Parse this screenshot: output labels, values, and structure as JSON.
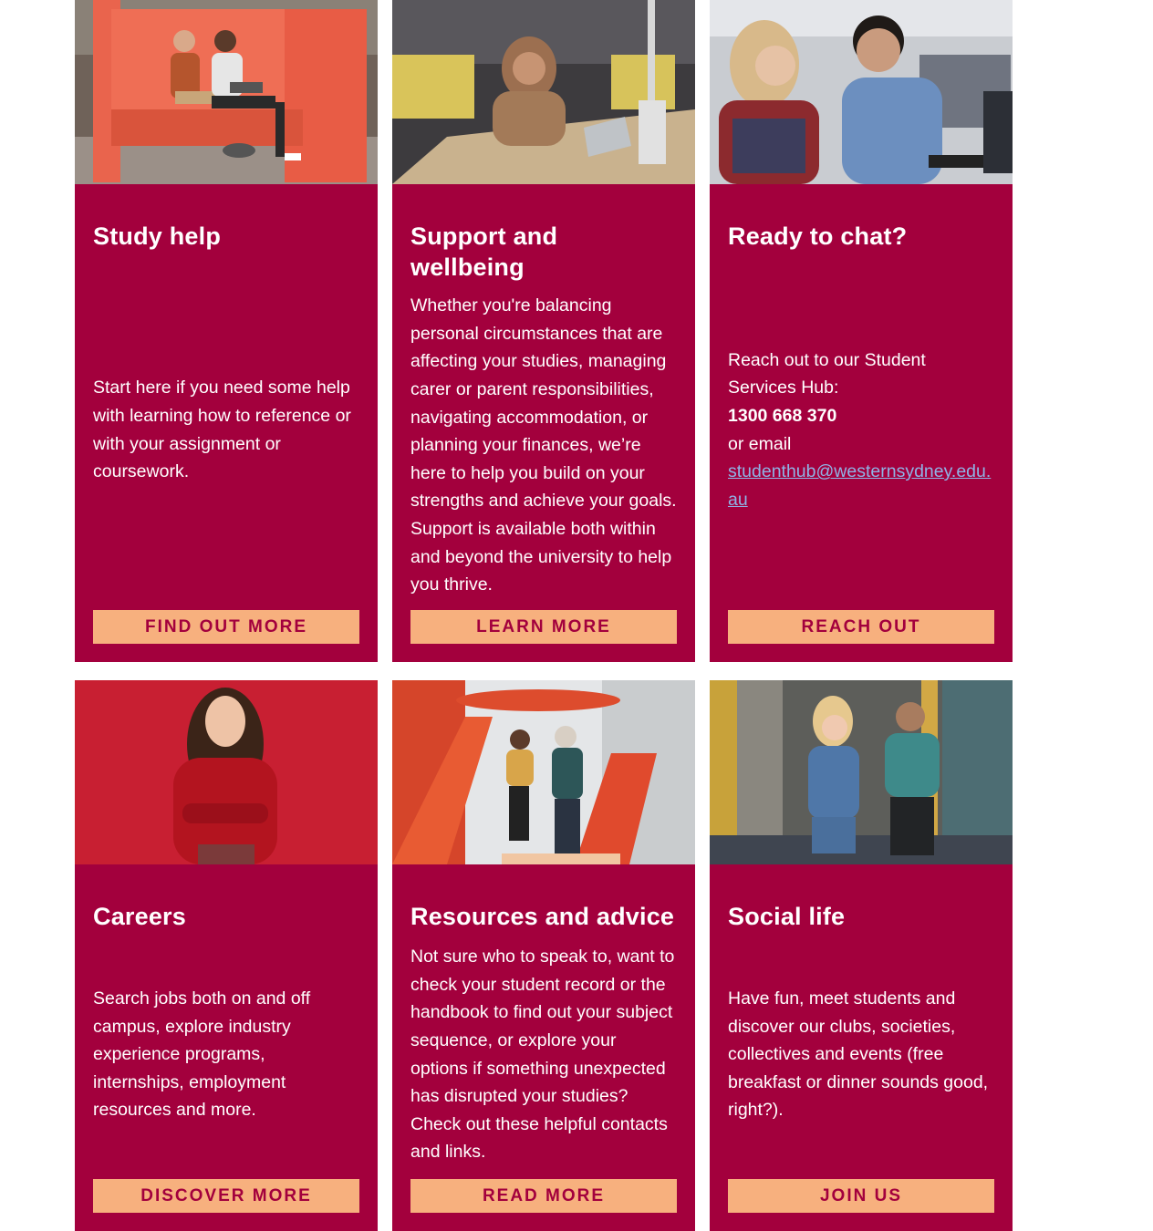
{
  "cards": [
    {
      "title": "Study help",
      "description": "Start here if you need some help with learning how to reference or with your assignment or coursework.",
      "button": "FIND OUT MORE"
    },
    {
      "title": "Support and wellbeing",
      "description": "Whether you're balancing personal circumstances that are affecting your studies, managing carer or parent responsibilities, navigating accommodation, or planning your finances, we’re here to help you build on your strengths and achieve your goals. Support is available both within and beyond the university to help you thrive.",
      "button": "LEARN MORE"
    },
    {
      "title": "Ready to chat?",
      "description_before": "Reach out to our Student Services Hub: ",
      "phone": "1300 668 370",
      "description_middle": " or email ",
      "email": "studenthub@westernsydney.edu.au",
      "button": "REACH OUT"
    },
    {
      "title": "Careers",
      "description": "Search jobs both on and off campus, explore industry experience programs, internships, employment resources and more.",
      "button": "DISCOVER MORE"
    },
    {
      "title": "Resources and advice",
      "description": "Not sure who to speak to, want to check your student record or the handbook to find out your subject sequence, or explore your options if something unexpected has disrupted your studies? Check out these helpful contacts and links.",
      "button": "READ MORE"
    },
    {
      "title": "Social life",
      "description": "Have fun, meet students and discover our clubs, societies, collectives and events (free breakfast or dinner sounds good, right?).",
      "button": "JOIN US"
    }
  ],
  "colors": {
    "card_background": "#a3003d",
    "button_background": "#f7b07e",
    "button_text": "#a3003d",
    "link": "#8fb3e6"
  }
}
